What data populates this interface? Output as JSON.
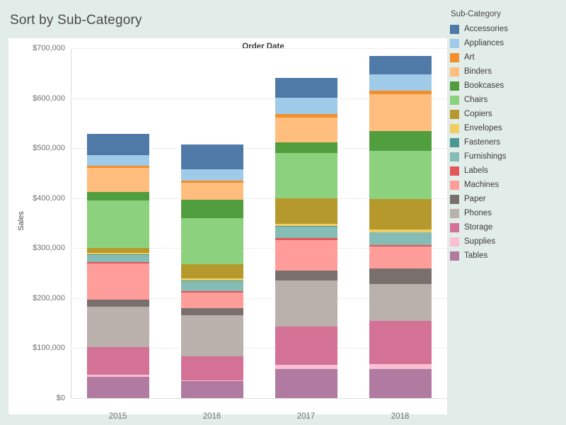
{
  "dashboard": {
    "title": "Sort by Sub-Category",
    "background_color": "#e2ece8",
    "panel_color": "#ffffff"
  },
  "legend": {
    "title": "Sub-Category",
    "items": [
      {
        "label": "Accessories",
        "color": "#4f79a7"
      },
      {
        "label": "Appliances",
        "color": "#a0cbe8"
      },
      {
        "label": "Art",
        "color": "#f28e2b"
      },
      {
        "label": "Binders",
        "color": "#ffbe7d"
      },
      {
        "label": "Bookcases",
        "color": "#519e3e"
      },
      {
        "label": "Chairs",
        "color": "#8cd17d"
      },
      {
        "label": "Copiers",
        "color": "#b6992d"
      },
      {
        "label": "Envelopes",
        "color": "#f1ce63"
      },
      {
        "label": "Fasteners",
        "color": "#499894"
      },
      {
        "label": "Furnishings",
        "color": "#86bcb6"
      },
      {
        "label": "Labels",
        "color": "#e15759"
      },
      {
        "label": "Machines",
        "color": "#ff9d9a"
      },
      {
        "label": "Paper",
        "color": "#79706e"
      },
      {
        "label": "Phones",
        "color": "#bab0ac"
      },
      {
        "label": "Storage",
        "color": "#d37295"
      },
      {
        "label": "Supplies",
        "color": "#fabfd2"
      },
      {
        "label": "Tables",
        "color": "#b07aa1"
      }
    ]
  },
  "chart_data": {
    "type": "bar",
    "subtype": "stacked",
    "title": "Order Date",
    "xlabel": "",
    "ylabel": "Sales",
    "categories": [
      "2015",
      "2016",
      "2017",
      "2018"
    ],
    "ylim": [
      0,
      700000
    ],
    "yticks": [
      0,
      100000,
      200000,
      300000,
      400000,
      500000,
      600000,
      700000
    ],
    "ytick_labels": [
      "$0",
      "$100,000",
      "$200,000",
      "$300,000",
      "$400,000",
      "$500,000",
      "$600,000",
      "$700,000"
    ],
    "grid": true,
    "legend_position": "right",
    "stack_order": [
      "Tables",
      "Supplies",
      "Storage",
      "Phones",
      "Paper",
      "Machines",
      "Labels",
      "Furnishings",
      "Fasteners",
      "Envelopes",
      "Copiers",
      "Chairs",
      "Bookcases",
      "Binders",
      "Art",
      "Appliances",
      "Accessories"
    ],
    "series": [
      {
        "name": "Accessories",
        "color": "#4f79a7",
        "values": [
          41900,
          49500,
          39800,
          36600
        ]
      },
      {
        "name": "Appliances",
        "color": "#a0cbe8",
        "values": [
          22300,
          21500,
          31600,
          32900
        ]
      },
      {
        "name": "Art",
        "color": "#f28e2b",
        "values": [
          4100,
          5400,
          7200,
          7500
        ]
      },
      {
        "name": "Binders",
        "color": "#ffbe7d",
        "values": [
          48000,
          34100,
          49300,
          72700
        ]
      },
      {
        "name": "Bookcases",
        "color": "#519e3e",
        "values": [
          16900,
          35800,
          21200,
          40200
        ]
      },
      {
        "name": "Chairs",
        "color": "#8cd17d",
        "values": [
          94900,
          92800,
          90900,
          97200
        ]
      },
      {
        "name": "Copiers",
        "color": "#b6992d",
        "values": [
          9600,
          27600,
          51900,
          60600
        ]
      },
      {
        "name": "Envelopes",
        "color": "#f1ce63",
        "values": [
          3300,
          4700,
          4300,
          4800
        ]
      },
      {
        "name": "Fasteners",
        "color": "#499894",
        "values": [
          900,
          800,
          900,
          1000
        ]
      },
      {
        "name": "Furnishings",
        "color": "#86bcb6",
        "values": [
          14700,
          20500,
          22700,
          24700
        ]
      },
      {
        "name": "Labels",
        "color": "#e15759",
        "values": [
          2900,
          3000,
          3600,
          2800
        ]
      },
      {
        "name": "Machines",
        "color": "#ff9d9a",
        "values": [
          71600,
          31100,
          61800,
          44900
        ]
      },
      {
        "name": "Paper",
        "color": "#79706e",
        "values": [
          13700,
          13900,
          20100,
          30500
        ]
      },
      {
        "name": "Phones",
        "color": "#bab0ac",
        "values": [
          81600,
          83000,
          92100,
          73800
        ]
      },
      {
        "name": "Storage",
        "color": "#d37295",
        "values": [
          54800,
          47500,
          75300,
          86800
        ]
      },
      {
        "name": "Supplies",
        "color": "#fabfd2",
        "values": [
          4200,
          1200,
          9500,
          9800
        ]
      },
      {
        "name": "Tables",
        "color": "#b07aa1",
        "values": [
          42900,
          34300,
          57800,
          57800
        ]
      }
    ],
    "totals": [
      528300,
      506700,
      640000,
      684600
    ]
  }
}
